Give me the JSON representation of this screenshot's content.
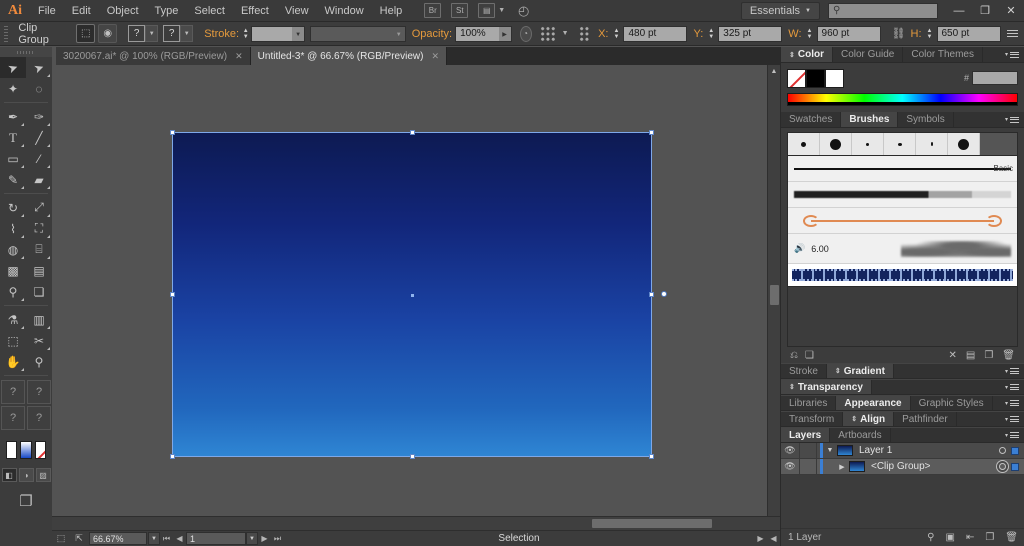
{
  "app": {
    "name": "Adobe Illustrator",
    "logo": "Ai"
  },
  "menubar": {
    "items": [
      "File",
      "Edit",
      "Object",
      "Type",
      "Select",
      "Effect",
      "View",
      "Window",
      "Help"
    ],
    "bridge_icon": "br-icon",
    "stock_icon": "st-icon",
    "arrange_icon": "arrange-documents-icon",
    "cc_icon": "creative-cloud-icon",
    "workspace": "Essentials",
    "search_placeholder": "",
    "minimize": "—",
    "restore": "❐",
    "close": "✕"
  },
  "controlbar": {
    "selection_label": "Clip Group",
    "isolate_icon": "isolate-selection-icon",
    "opacity_mask_icon": "opacity-mask-icon",
    "fill_label": "?",
    "stroke_swatch_label": "?",
    "stroke_label": "Stroke:",
    "stroke_weight": "",
    "stroke_profile": "",
    "opacity_label": "Opacity:",
    "opacity_value": "100%",
    "recolor_icon": "recolor-artwork-icon",
    "transform_icon": "transform-icon",
    "align_icon": "align-reference-icon",
    "x_label": "X:",
    "x_value": "480 pt",
    "y_label": "Y:",
    "y_value": "325 pt",
    "w_label": "W:",
    "w_value": "960 pt",
    "lock_icon": "constrain-proportions-icon",
    "h_label": "H:",
    "h_value": "650 pt",
    "panel_menu_icon": "panel-menu-icon"
  },
  "tabs": [
    {
      "title": "3020067.ai* @ 100% (RGB/Preview)",
      "active": false,
      "close": "✕"
    },
    {
      "title": "Untitled-3* @ 66.67% (RGB/Preview)",
      "active": true,
      "close": "✕"
    }
  ],
  "toolbar": {
    "tools": [
      {
        "name": "selection-tool",
        "glyph": "➤",
        "selected": true,
        "corner": false
      },
      {
        "name": "direct-selection-tool",
        "glyph": "➤",
        "selected": false,
        "corner": true
      },
      {
        "name": "magic-wand-tool",
        "glyph": "✦",
        "selected": false,
        "corner": false
      },
      {
        "name": "lasso-tool",
        "glyph": "◌",
        "selected": false,
        "corner": false
      },
      {
        "name": "pen-tool",
        "glyph": "✒",
        "selected": false,
        "corner": true
      },
      {
        "name": "curvature-tool",
        "glyph": "✑",
        "selected": false,
        "corner": false
      },
      {
        "name": "type-tool",
        "glyph": "T",
        "selected": false,
        "corner": true
      },
      {
        "name": "line-segment-tool",
        "glyph": "╱",
        "selected": false,
        "corner": true
      },
      {
        "name": "rectangle-tool",
        "glyph": "▭",
        "selected": false,
        "corner": true
      },
      {
        "name": "paintbrush-tool",
        "glyph": "🖌",
        "selected": false,
        "corner": true
      },
      {
        "name": "pencil-tool",
        "glyph": "✎",
        "selected": false,
        "corner": true
      },
      {
        "name": "eraser-tool",
        "glyph": "▰",
        "selected": false,
        "corner": true
      },
      {
        "name": "rotate-tool",
        "glyph": "↻",
        "selected": false,
        "corner": true
      },
      {
        "name": "scale-tool",
        "glyph": "⤢",
        "selected": false,
        "corner": true
      },
      {
        "name": "width-tool",
        "glyph": "⌇",
        "selected": false,
        "corner": true
      },
      {
        "name": "free-transform-tool",
        "glyph": "⛶",
        "selected": false,
        "corner": true
      },
      {
        "name": "shape-builder-tool",
        "glyph": "◍",
        "selected": false,
        "corner": true
      },
      {
        "name": "perspective-grid-tool",
        "glyph": "⌸",
        "selected": false,
        "corner": true
      },
      {
        "name": "mesh-tool",
        "glyph": "▩",
        "selected": false,
        "corner": false
      },
      {
        "name": "gradient-tool",
        "glyph": "▤",
        "selected": false,
        "corner": false
      },
      {
        "name": "eyedropper-tool",
        "glyph": "⚲",
        "selected": false,
        "corner": true
      },
      {
        "name": "blend-tool",
        "glyph": "❏",
        "selected": false,
        "corner": false
      },
      {
        "name": "symbol-sprayer-tool",
        "glyph": "⚗",
        "selected": false,
        "corner": true
      },
      {
        "name": "column-graph-tool",
        "glyph": "▥",
        "selected": false,
        "corner": true
      },
      {
        "name": "artboard-tool",
        "glyph": "⬚",
        "selected": false,
        "corner": false
      },
      {
        "name": "slice-tool",
        "glyph": "✂",
        "selected": false,
        "corner": true
      },
      {
        "name": "hand-tool",
        "glyph": "✋",
        "selected": false,
        "corner": true
      },
      {
        "name": "zoom-tool",
        "glyph": "⚲",
        "selected": false,
        "corner": false
      }
    ],
    "extra_boxes": [
      "?",
      "?",
      "?",
      "?"
    ],
    "fill_swatch": "white",
    "gradient_swatch": "blue-gradient",
    "none_swatch": "none",
    "color_mode_icons": [
      "color-mode-icon",
      "gradient-mode-icon",
      "none-mode-icon"
    ],
    "screen_mode_icon": "screen-mode-icon"
  },
  "canvas": {
    "artwork_name": "gradient-rectangle",
    "gradient_top": "#0d1a52",
    "gradient_bottom": "#2f86d4",
    "selection_color": "#7ea8e8",
    "cursor": "selection-arrow-cursor"
  },
  "statusbar": {
    "artboard_icon": "artboard-navigation-icon",
    "share_icon": "share-icon",
    "zoom_value": "66.67%",
    "first_icon": "first-artboard-icon",
    "prev_icon": "previous-artboard-icon",
    "page_value": "1",
    "next_icon": "next-artboard-icon",
    "last_icon": "last-artboard-icon",
    "status_text": "Selection",
    "status_caret": "▶",
    "scroll_left": "◀"
  },
  "panels": {
    "color_group": {
      "tabs": [
        "Color",
        "Color Guide",
        "Color Themes"
      ],
      "active": "Color",
      "swatches": [
        "none",
        "black",
        "white"
      ],
      "hash": "#",
      "hex_value": "",
      "spectrum_name": "color-spectrum-ramp"
    },
    "brush_group": {
      "tabs": [
        "Swatches",
        "Brushes",
        "Symbols"
      ],
      "active": "Brushes",
      "preset_dots": [
        4,
        9,
        2.5,
        3.5,
        1.5,
        9
      ],
      "basic_label": "Basic",
      "charcoal_name": "charcoal-brush",
      "arrow_name": "arrow-pattern-brush",
      "size_value": "6.00",
      "speaker_icon": "brush-preview-icon",
      "pattern_name": "blue-pattern-brush",
      "footer_icons": [
        "brush-libraries-icon",
        "libraries-panel-icon",
        "remove-brush-link-icon",
        "options-icon",
        "new-brush-icon",
        "delete-brush-icon"
      ]
    },
    "stroke_gradient": {
      "tabs": [
        "Stroke",
        "Gradient"
      ],
      "active": "Gradient"
    },
    "transparency": {
      "tabs": [
        "Transparency"
      ],
      "active": "Transparency"
    },
    "appearance": {
      "tabs": [
        "Libraries",
        "Appearance",
        "Graphic Styles"
      ],
      "active": "Appearance"
    },
    "align": {
      "tabs": [
        "Transform",
        "Align",
        "Pathfinder"
      ],
      "active": "Align"
    },
    "layers": {
      "tabs": [
        "Layers",
        "Artboards"
      ],
      "active": "Layers",
      "rows": [
        {
          "name": "Layer 1",
          "indent": 0,
          "expanded": true,
          "eye": "👁",
          "selected": false
        },
        {
          "name": "<Clip Group>",
          "indent": 1,
          "expanded": false,
          "eye": "👁",
          "selected": true
        }
      ],
      "footer_count": "1 Layer",
      "footer_icons": [
        "locate-object-icon",
        "make-clipping-mask-icon",
        "create-sublayer-icon",
        "create-new-layer-icon",
        "delete-selection-icon"
      ]
    }
  }
}
